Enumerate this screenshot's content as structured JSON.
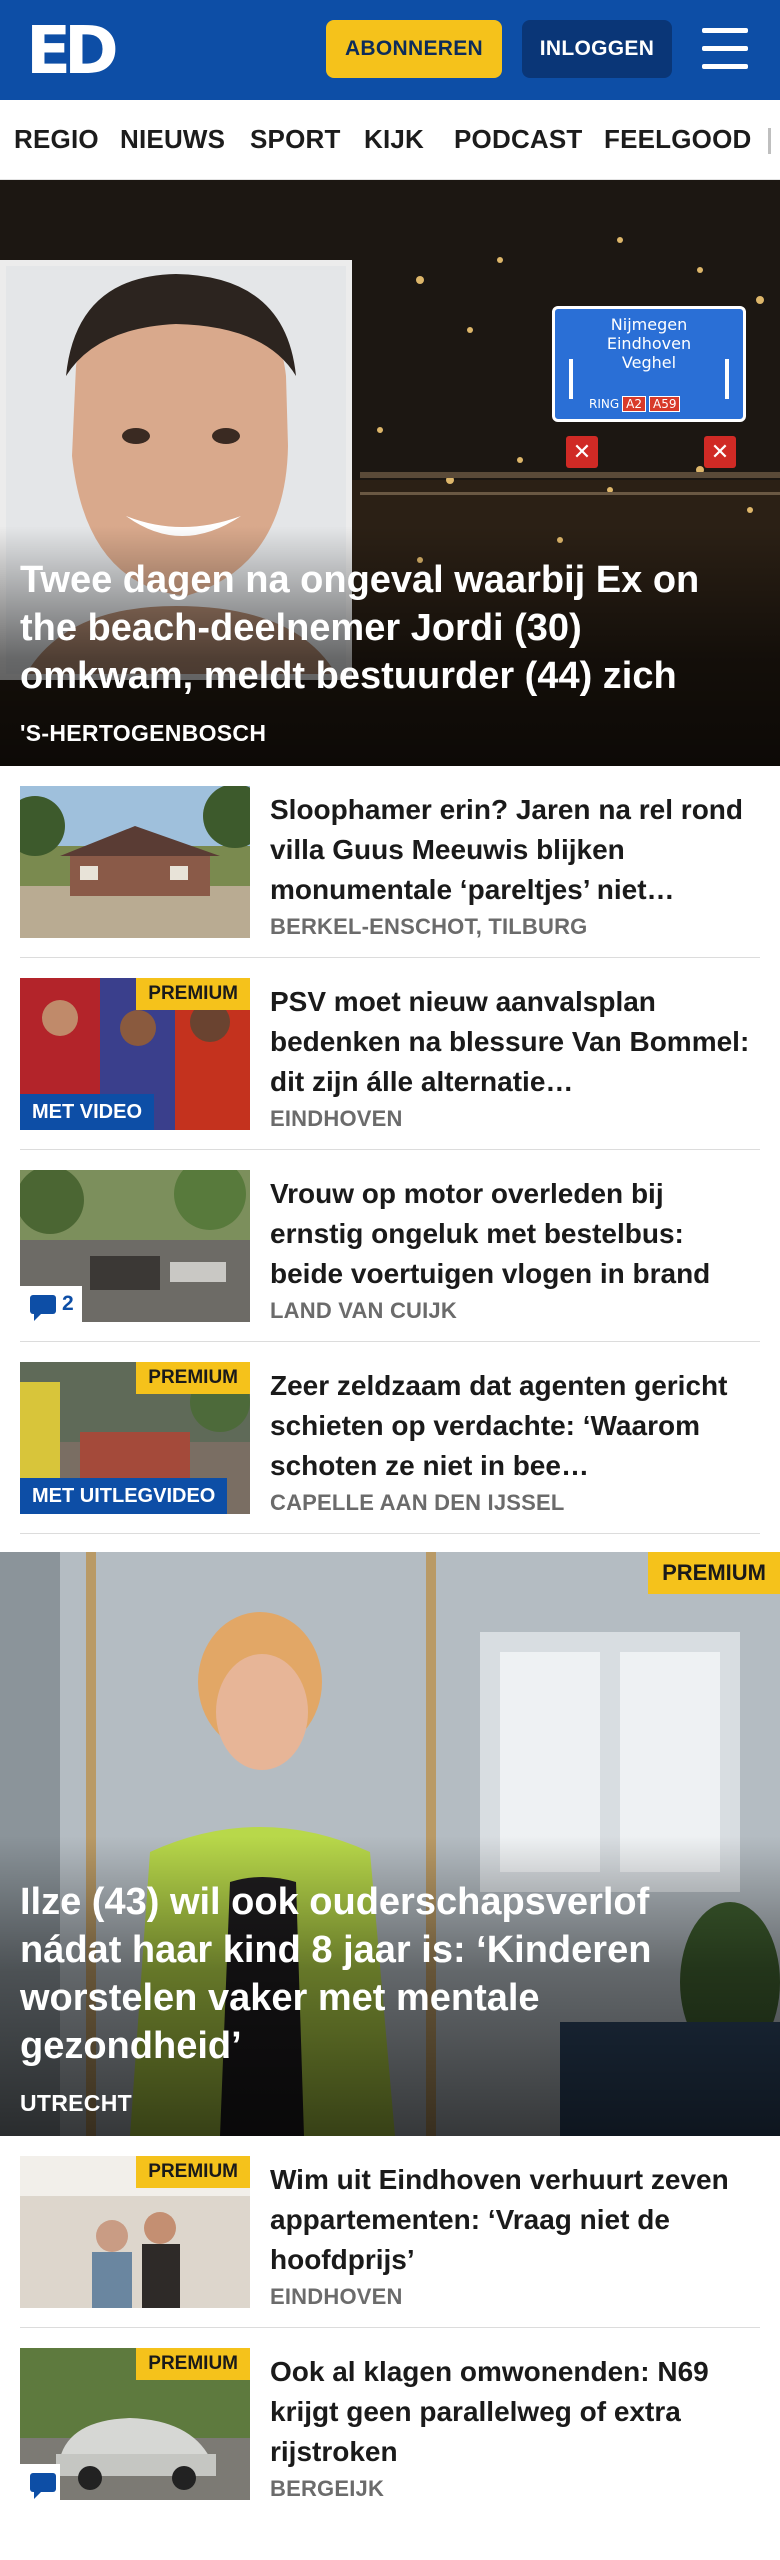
{
  "header": {
    "logo": {
      "letter1": "E",
      "letter2": "D"
    },
    "subscribe_label": "ABONNEREN",
    "login_label": "INLOGGEN",
    "menu_icon": "hamburger-icon",
    "background_color": "#0d4ea6",
    "accent_color": "#f5c21b"
  },
  "nav": {
    "items": [
      {
        "label": "REGIO"
      },
      {
        "label": "NIEUWS"
      },
      {
        "label": "SPORT"
      },
      {
        "label": "KIJK"
      },
      {
        "label": "PODCAST"
      },
      {
        "label": "FEELGOOD"
      }
    ]
  },
  "hero": {
    "title": "Twee dagen na ongeval waarbij Ex on the beach-deelnemer Jordi (30) omkwam, meldt bestuurder (44) zich",
    "location": "'S-HERTOGENBOSCH",
    "sign": {
      "line1": "Nijmegen",
      "line2": "Eindhoven",
      "line3": "Veghel",
      "ring": "RING",
      "road1": "A2",
      "road2": "A59"
    }
  },
  "articles": [
    {
      "title": "Sloophamer erin? Jaren na rel rond villa Guus Meeuwis blijken monumentale ‘pareltjes’ niet…",
      "location": "BERKEL-ENSCHOT, TILBURG",
      "premium": false
    },
    {
      "title": "PSV moet nieuw aanvalsplan bedenken na blessure Van Bommel: dit zijn álle alternatie…",
      "location": "EINDHOVEN",
      "premium": true,
      "premium_label": "PREMIUM",
      "video_label": "MET VIDEO"
    },
    {
      "title": "Vrouw op motor overleden bij ernstig ongeluk met bestelbus: beide voertuigen vlogen in brand",
      "location": "LAND VAN CUIJK",
      "premium": false,
      "comments": "2"
    },
    {
      "title": "Zeer zeldzaam dat agenten gericht schieten op verdachte: ‘Waarom schoten ze niet in bee…",
      "location": "CAPELLE AAN DEN IJSSEL",
      "premium": true,
      "premium_label": "PREMIUM",
      "video_label": "MET UITLEGVIDEO"
    }
  ],
  "hero2": {
    "premium_label": "PREMIUM",
    "title": "Ilze (43) wil ook ouderschapsverlof nádat haar kind 8 jaar is: ‘Kinderen worstelen vaker met mentale gezondheid’",
    "location": "UTRECHT"
  },
  "articles2": [
    {
      "title": "Wim uit Eindhoven verhuurt zeven appartementen: ‘Vraag niet de hoofdprijs’",
      "location": "EINDHOVEN",
      "premium_label": "PREMIUM"
    },
    {
      "title": "Ook al klagen omwonenden: N69 krijgt geen parallelweg of extra rijstroken",
      "location": "BERGEIJK",
      "premium_label": "PREMIUM"
    }
  ]
}
